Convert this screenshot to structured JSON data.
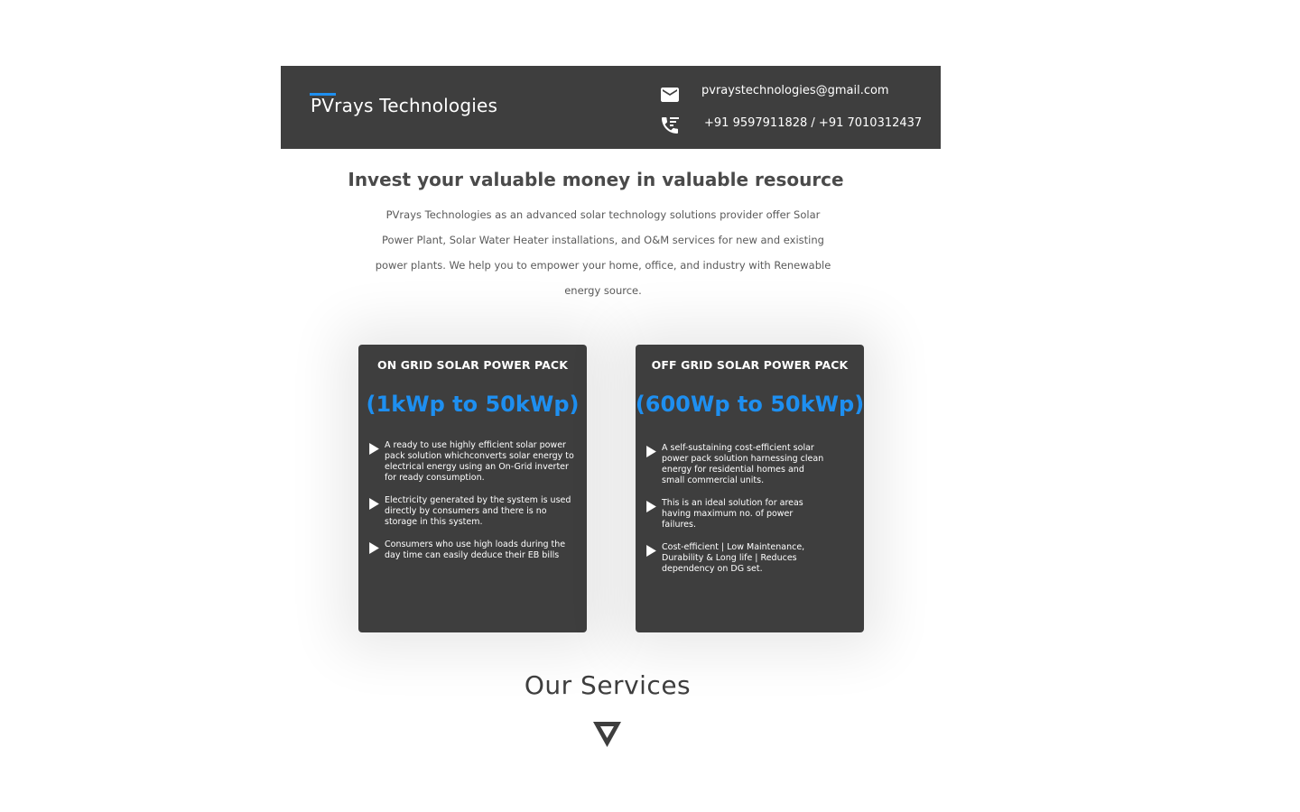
{
  "header": {
    "brand": "PVrays Technologies",
    "email": "pvraystechnologies@gmail.com",
    "phone": "+91 9597911828 / +91 7010312437",
    "email_icon": "mail-icon",
    "phone_icon": "phone-icon"
  },
  "hero": {
    "headline": "Invest your valuable money in valuable resource",
    "intro": "PVrays Technologies as an advanced solar technology solutions provider offer Solar Power Plant, Solar Water Heater installations, and O&M services for new and existing power plants. We help you to empower your home, office, and industry with Renewable energy source."
  },
  "cards": [
    {
      "title": "ON GRID SOLAR POWER PACK",
      "range": "(1kWp to 50kWp)",
      "bullets": [
        "A ready to use highly efficient solar power pack solution whichconverts solar energy to electrical energy using an On-Grid inverter for ready consumption.",
        "Electricity generated by the system is used directly by consumers and there is no storage in this system.",
        "Consumers who use high loads during the day time can easily deduce their EB bills"
      ]
    },
    {
      "title": "OFF GRID SOLAR POWER PACK",
      "range": "(600Wp to 50kWp)",
      "bullets": [
        "A self-sustaining cost-efficient solar power pack solution harnessing clean energy for residential homes and small commercial units.",
        "This is an ideal solution for areas having maximum no. of power failures.",
        "Cost-efficient | Low Maintenance, Durability & Long life | Reduces dependency on DG set."
      ]
    }
  ],
  "services": {
    "title": "Our Services",
    "icon": "down-triangle-icon"
  },
  "colors": {
    "dark": "#3e3e3e",
    "accent": "#1e8ff0",
    "text": "#4a4a4a"
  }
}
